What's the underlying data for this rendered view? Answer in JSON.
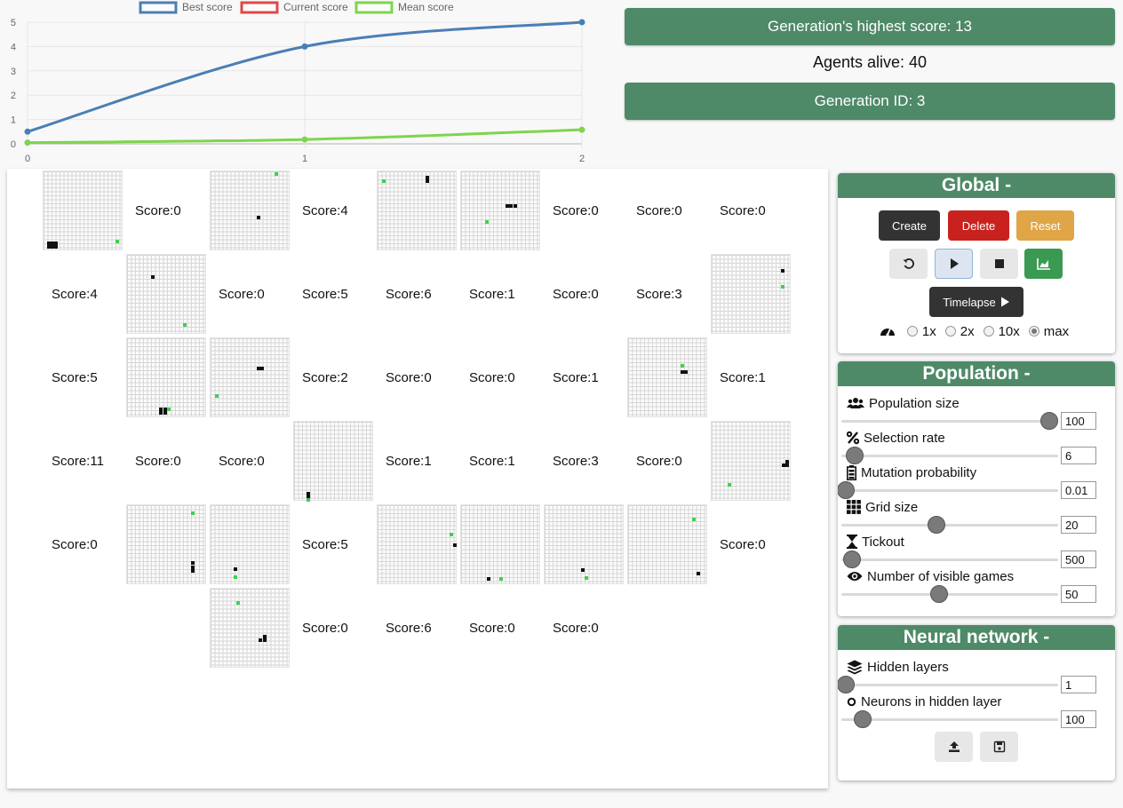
{
  "chart_data": {
    "type": "line",
    "x": [
      0,
      1,
      2
    ],
    "xlim": [
      0,
      2
    ],
    "ylim": [
      0,
      5
    ],
    "yticks": [
      0,
      1,
      2,
      3,
      4,
      5
    ],
    "grid": true,
    "legend_position": "top",
    "series": [
      {
        "name": "Best score",
        "values": [
          0.5,
          4,
          5
        ],
        "color": "#4a7fb5"
      },
      {
        "name": "Current score",
        "values": [
          null,
          null,
          null
        ],
        "color": "#e04848"
      },
      {
        "name": "Mean score",
        "values": [
          0.05,
          0.18,
          0.58
        ],
        "color": "#7fd44d"
      }
    ]
  },
  "stats": {
    "highest_score": "Generation's highest score: 13",
    "agents_alive": "Agents alive: 40",
    "generation_id": "Generation ID: 3"
  },
  "games": [
    {
      "type": "grid",
      "snake": [
        [
          0.8,
          18.4
        ],
        [
          1.7,
          18.4
        ],
        [
          2.6,
          18.4
        ],
        [
          0.8,
          17.5
        ],
        [
          1.7,
          17.5
        ],
        [
          2.6,
          17.5
        ]
      ],
      "food": [
        [
          17.9,
          17.0
        ]
      ]
    },
    {
      "type": "score",
      "text": "Score:0"
    },
    {
      "type": "grid",
      "snake": [
        [
          11.5,
          11.0
        ]
      ],
      "food": [
        [
          16.0,
          0.3
        ]
      ]
    },
    {
      "type": "score",
      "text": "Score:4"
    },
    {
      "type": "grid",
      "snake": [
        [
          12.0,
          1.2
        ],
        [
          12.0,
          2.1
        ]
      ],
      "food": [
        [
          1.0,
          2.1
        ]
      ]
    },
    {
      "type": "grid",
      "snake": [
        [
          11.0,
          8.2
        ],
        [
          12.0,
          8.2
        ],
        [
          13.0,
          8.2
        ]
      ],
      "food": [
        [
          6.0,
          12.2
        ]
      ]
    },
    {
      "type": "score",
      "text": "Score:0"
    },
    {
      "type": "score",
      "text": "Score:0"
    },
    {
      "type": "score",
      "text": "Score:0"
    },
    {
      "type": "score",
      "text": "Score:4"
    },
    {
      "type": "grid",
      "snake": [
        [
          6.0,
          5.0
        ]
      ],
      "food": [
        [
          14.0,
          17.0
        ]
      ]
    },
    {
      "type": "score",
      "text": "Score:0"
    },
    {
      "type": "score",
      "text": "Score:5"
    },
    {
      "type": "score",
      "text": "Score:6"
    },
    {
      "type": "score",
      "text": "Score:1"
    },
    {
      "type": "score",
      "text": "Score:0"
    },
    {
      "type": "score",
      "text": "Score:3"
    },
    {
      "type": "grid",
      "snake": [
        [
          17.3,
          3.5
        ]
      ],
      "food": [
        [
          17.3,
          7.5
        ]
      ]
    },
    {
      "type": "score",
      "text": "Score:5"
    },
    {
      "type": "grid",
      "snake": [
        [
          8.0,
          17.3
        ],
        [
          9.0,
          17.3
        ],
        [
          8.0,
          18.3
        ],
        [
          9.0,
          18.3
        ]
      ],
      "food": [
        [
          10.0,
          17.3
        ]
      ]
    },
    {
      "type": "grid",
      "snake": [
        [
          11.5,
          7.0
        ],
        [
          12.5,
          7.0
        ]
      ],
      "food": [
        [
          1.0,
          14.0
        ]
      ]
    },
    {
      "type": "score",
      "text": "Score:2"
    },
    {
      "type": "score",
      "text": "Score:0"
    },
    {
      "type": "score",
      "text": "Score:0"
    },
    {
      "type": "score",
      "text": "Score:1"
    },
    {
      "type": "grid",
      "snake": [
        [
          13.0,
          8.0
        ],
        [
          14.0,
          8.0
        ]
      ],
      "food": [
        [
          13.0,
          6.5
        ]
      ]
    },
    {
      "type": "score",
      "text": "Score:1"
    },
    {
      "type": "score",
      "text": "Score:11"
    },
    {
      "type": "score",
      "text": "Score:0"
    },
    {
      "type": "score",
      "text": "Score:0"
    },
    {
      "type": "grid",
      "snake": [
        [
          3.0,
          17.5
        ],
        [
          3.0,
          18.5
        ]
      ],
      "food": [
        [
          3.0,
          19.2
        ]
      ]
    },
    {
      "type": "score",
      "text": "Score:1"
    },
    {
      "type": "score",
      "text": "Score:1"
    },
    {
      "type": "score",
      "text": "Score:3"
    },
    {
      "type": "score",
      "text": "Score:0"
    },
    {
      "type": "grid",
      "snake": [
        [
          18.5,
          9.5
        ],
        [
          18.5,
          10.5
        ],
        [
          17.5,
          10.5
        ]
      ],
      "food": [
        [
          4.0,
          15.3
        ]
      ]
    },
    {
      "type": "score",
      "text": "Score:0"
    },
    {
      "type": "grid",
      "snake": [
        [
          16.0,
          14.0
        ],
        [
          16.0,
          15.0
        ],
        [
          16.0,
          16.0
        ]
      ],
      "food": [
        [
          16.0,
          1.5
        ]
      ]
    },
    {
      "type": "grid",
      "snake": [
        [
          5.8,
          15.5
        ]
      ],
      "food": [
        [
          5.8,
          17.5
        ]
      ]
    },
    {
      "type": "score",
      "text": "Score:5"
    },
    {
      "type": "grid",
      "snake": [
        [
          18.8,
          9.5
        ]
      ],
      "food": [
        [
          18.0,
          6.8
        ]
      ]
    },
    {
      "type": "grid",
      "snake": [
        [
          6.5,
          18.0
        ]
      ],
      "food": [
        [
          9.5,
          18.0
        ]
      ]
    },
    {
      "type": "grid",
      "snake": [
        [
          9.0,
          15.8
        ]
      ],
      "food": [
        [
          10.0,
          17.8
        ]
      ]
    },
    {
      "type": "grid",
      "food": [
        [
          16.0,
          3.0
        ]
      ],
      "snake": [
        [
          17.0,
          16.7
        ]
      ]
    },
    {
      "type": "score",
      "text": "Score:0"
    },
    {
      "type": "grid",
      "snake": [
        [
          12.0,
          12.5
        ],
        [
          13.0,
          12.5
        ],
        [
          13.0,
          11.5
        ]
      ],
      "food": [
        [
          6.5,
          3.0
        ]
      ]
    },
    {
      "type": "score",
      "text": "Score:0"
    },
    {
      "type": "score",
      "text": "Score:6"
    },
    {
      "type": "score",
      "text": "Score:0"
    },
    {
      "type": "score",
      "text": "Score:0"
    }
  ],
  "global": {
    "title": "Global -",
    "create_label": "Create",
    "delete_label": "Delete",
    "reset_label": "Reset",
    "timelapse_label": "Timelapse",
    "speed_options": [
      "1x",
      "2x",
      "10x",
      "max"
    ],
    "speed_selected": "max"
  },
  "population": {
    "title": "Population -",
    "params": [
      {
        "label": "Population size",
        "value": "100",
        "icon": "users-icon",
        "level": 0.96
      },
      {
        "label": "Selection rate",
        "value": "6",
        "icon": "percent-icon",
        "level": 0.06
      },
      {
        "label": "Mutation probability",
        "value": "0.01",
        "icon": "battery-icon",
        "level": 0.02
      },
      {
        "label": "Grid size",
        "value": "20",
        "icon": "grid-icon",
        "level": 0.44
      },
      {
        "label": "Tickout",
        "value": "500",
        "icon": "hourglass-icon",
        "level": 0.05
      },
      {
        "label": "Number of visible games",
        "value": "50",
        "icon": "eye-icon",
        "level": 0.45
      }
    ]
  },
  "network": {
    "title": "Neural network -",
    "params": [
      {
        "label": "Hidden layers",
        "value": "1",
        "icon": "layers-icon",
        "level": 0.02
      },
      {
        "label": "Neurons in hidden layer",
        "value": "100",
        "icon": "circle-icon",
        "level": 0.1
      }
    ]
  }
}
